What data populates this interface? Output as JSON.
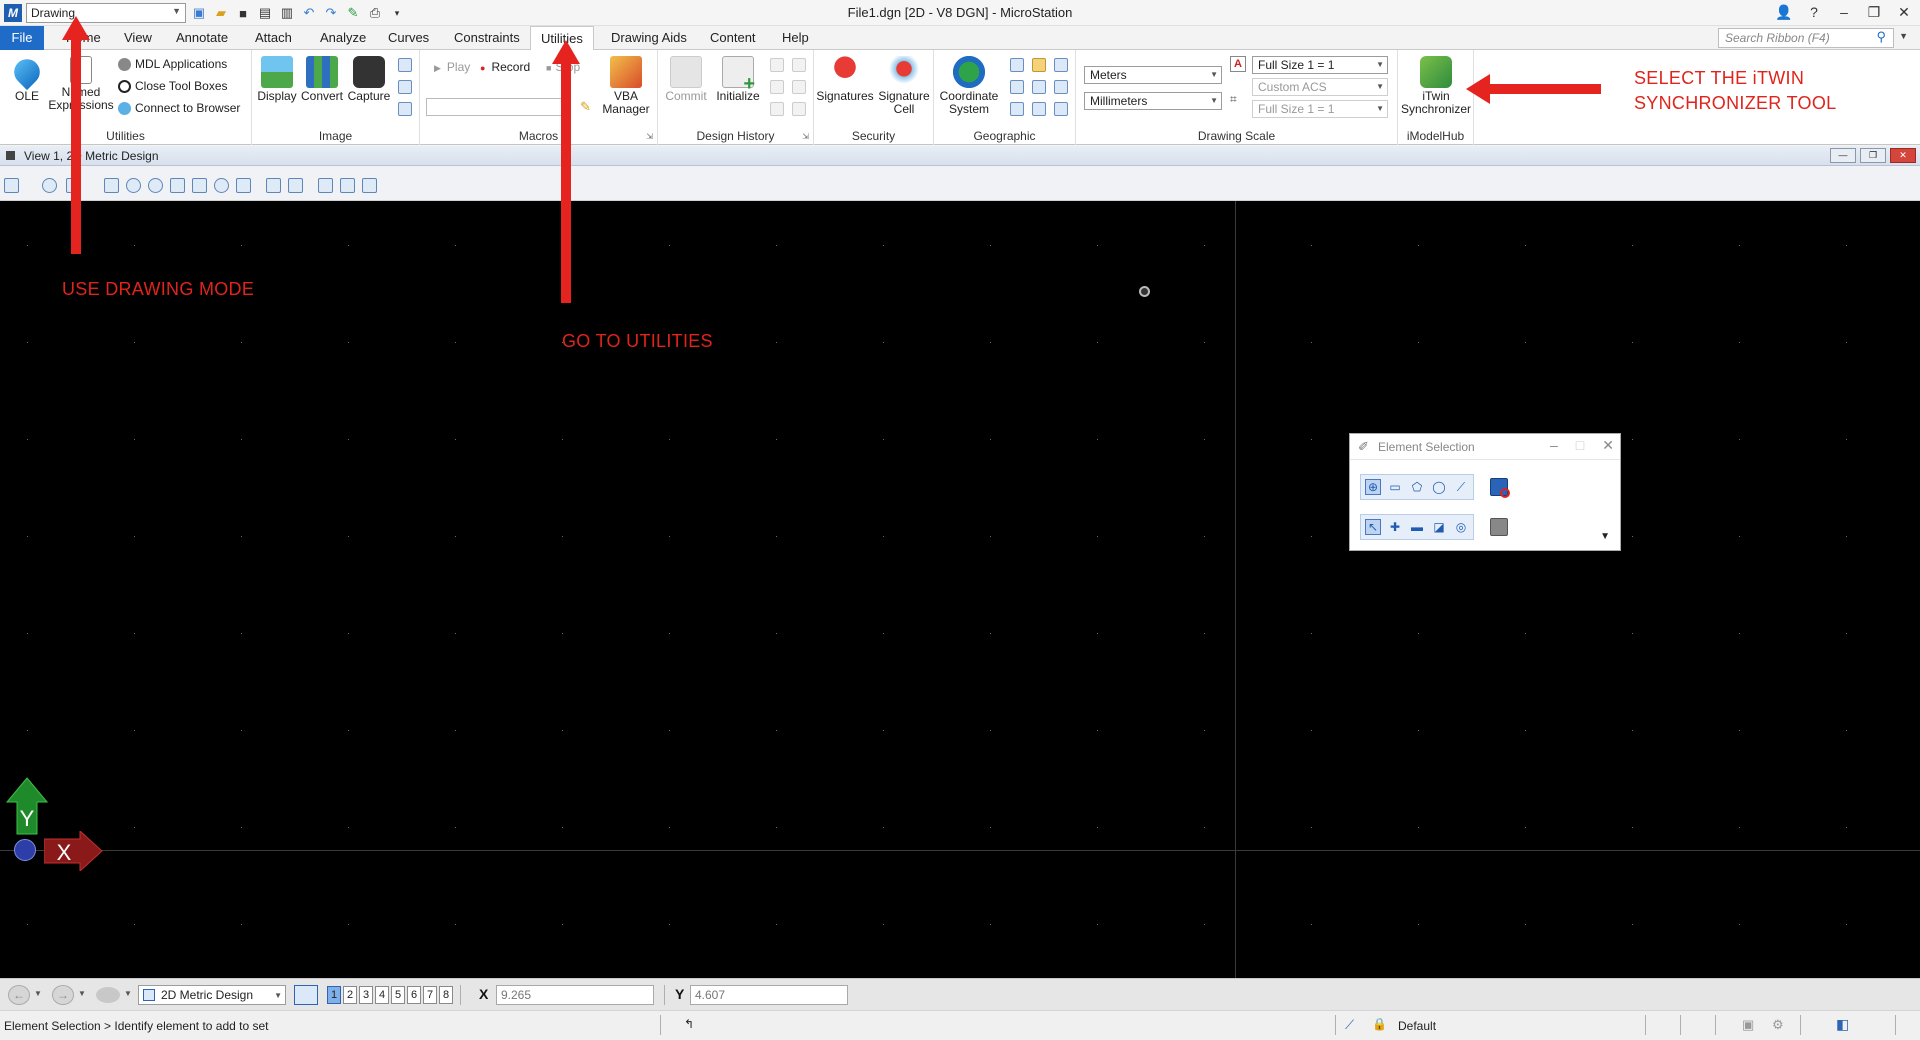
{
  "titlebar": {
    "workflow": "Drawing",
    "title": "File1.dgn [2D - V8 DGN] - MicroStation",
    "help": "?"
  },
  "tabs": [
    {
      "label": "File"
    },
    {
      "label": "Home"
    },
    {
      "label": "View"
    },
    {
      "label": "Annotate"
    },
    {
      "label": "Attach"
    },
    {
      "label": "Analyze"
    },
    {
      "label": "Curves"
    },
    {
      "label": "Constraints"
    },
    {
      "label": "Utilities"
    },
    {
      "label": "Drawing Aids"
    },
    {
      "label": "Content"
    },
    {
      "label": "Help"
    }
  ],
  "search": {
    "placeholder": "Search Ribbon (F4)"
  },
  "ribbon": {
    "utilities": {
      "label": "Utilities",
      "ole": "OLE",
      "named_expressions": [
        "Named",
        "Expressions"
      ],
      "mdl": "MDL Applications",
      "close_tool_boxes": "Close Tool Boxes",
      "connect_browser": "Connect to Browser"
    },
    "image": {
      "label": "Image",
      "display": "Display",
      "convert": "Convert",
      "capture": "Capture"
    },
    "macros": {
      "label": "Macros",
      "play": "Play",
      "record": "Record",
      "stop": "Stop",
      "vba": [
        "VBA",
        "Manager"
      ]
    },
    "design_history": {
      "label": "Design History",
      "commit": "Commit",
      "initialize": "Initialize"
    },
    "security": {
      "label": "Security",
      "signatures": "Signatures",
      "signature_cell": [
        "Signature",
        "Cell"
      ]
    },
    "geographic": {
      "label": "Geographic",
      "coordinate_system": [
        "Coordinate",
        "System"
      ]
    },
    "drawing_scale": {
      "label": "Drawing Scale",
      "master_units": "Meters",
      "sub_units": "Millimeters",
      "scale1": "Full Size 1 = 1",
      "acs": "Custom ACS",
      "scale2": "Full Size 1 = 1"
    },
    "imodelhub": {
      "label": "iModelHub",
      "itwin": [
        "iTwin",
        "Synchronizer"
      ]
    }
  },
  "view": {
    "title": "View 1, 2D Metric Design"
  },
  "annotations": {
    "drawing_mode": "USE DRAWING MODE",
    "utilities": "GO TO UTILITIES",
    "itwin_line1": "SELECT THE iTWIN",
    "itwin_line2": "SYNCHRONIZER TOOL"
  },
  "element_selection": {
    "title": "Element Selection"
  },
  "axis": {
    "y": "Y",
    "x": "X"
  },
  "statusbar": {
    "model": "2D Metric Design",
    "view_numbers": [
      "1",
      "2",
      "3",
      "4",
      "5",
      "6",
      "7",
      "8"
    ],
    "x_label": "X",
    "x_value": "9.265",
    "y_label": "Y",
    "y_value": "4.607",
    "prompt": "Element Selection > Identify element to add to set",
    "level": "Default"
  },
  "colors": {
    "accent": "#1e6cc8",
    "annotation": "#e0241b",
    "canvas": "#000000"
  }
}
